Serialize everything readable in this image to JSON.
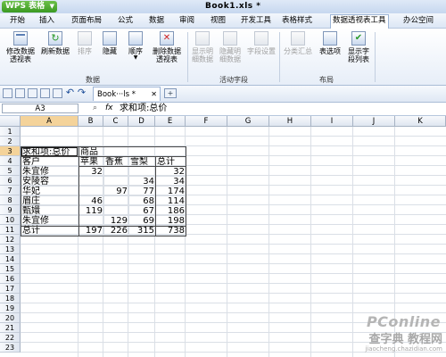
{
  "app": {
    "button_label": "WPS 表格",
    "doc_title": "Book1.xls *"
  },
  "menus": [
    "开始",
    "插入",
    "页面布局",
    "公式",
    "数据",
    "审阅",
    "视图",
    "开发工具",
    "表格样式",
    "数据透视表工具",
    "办公空间"
  ],
  "active_menu": "数据透视表工具",
  "ribbon": {
    "groups": [
      {
        "label": "数据",
        "buttons": [
          {
            "label": "修改数据\n透视表",
            "icon": "pivot-edit-icon",
            "enabled": true
          },
          {
            "label": "刷新数据",
            "icon": "refresh-icon",
            "enabled": true
          },
          {
            "label": "排序",
            "icon": "sort-icon",
            "enabled": false
          },
          {
            "label": "隐藏",
            "icon": "hide-icon",
            "enabled": true
          },
          {
            "label": "顺序",
            "icon": "order-icon",
            "enabled": true
          },
          {
            "label": "删除数据\n透视表",
            "icon": "delete-pivot-icon",
            "enabled": true
          }
        ]
      },
      {
        "label": "活动字段",
        "buttons": [
          {
            "label": "显示明\n细数据",
            "icon": "show-detail-icon",
            "enabled": false
          },
          {
            "label": "隐藏明\n细数据",
            "icon": "hide-detail-icon",
            "enabled": false
          },
          {
            "label": "字段设置",
            "icon": "field-settings-icon",
            "enabled": false
          }
        ]
      },
      {
        "label": "布局",
        "buttons": [
          {
            "label": "分类汇总",
            "icon": "subtotal-icon",
            "enabled": false
          },
          {
            "label": "表选项",
            "icon": "table-options-icon",
            "enabled": true
          },
          {
            "label": "显示字\n段列表",
            "icon": "field-list-icon",
            "enabled": true
          }
        ]
      }
    ]
  },
  "quickbar": {
    "tab_label": "Book···ls *"
  },
  "formula_bar": {
    "cell_ref": "A3",
    "fx": "fx",
    "content": "求和项:总价"
  },
  "sheet": {
    "columns": [
      "A",
      "B",
      "C",
      "D",
      "E",
      "F",
      "G",
      "H",
      "I",
      "J",
      "K"
    ],
    "rows": [
      "1",
      "2",
      "3",
      "4",
      "5",
      "6",
      "7",
      "8",
      "9",
      "10",
      "11",
      "12",
      "13",
      "14",
      "15",
      "16",
      "17",
      "18",
      "19",
      "20",
      "21",
      "22",
      "23"
    ],
    "pivot": {
      "row3": {
        "a": "求和项:总价",
        "b": "商品"
      },
      "row4": {
        "a": "客户",
        "b": "苹果",
        "c": "香蕉",
        "d": "雪梨",
        "e": "总计"
      },
      "data": [
        {
          "a": " 朱宜修",
          "b": "32",
          "c": "",
          "d": "",
          "e": "32"
        },
        {
          "a": "安陵容",
          "b": "",
          "c": "",
          "d": "34",
          "e": "34"
        },
        {
          "a": "华妃",
          "b": "",
          "c": "97",
          "d": "77",
          "e": "174"
        },
        {
          "a": "眉庄",
          "b": "46",
          "c": "",
          "d": "68",
          "e": "114"
        },
        {
          "a": "甄嬛",
          "b": "119",
          "c": "",
          "d": "67",
          "e": "186"
        },
        {
          "a": "朱宜修",
          "b": "",
          "c": "129",
          "d": "69",
          "e": "198"
        },
        {
          "a": "总计",
          "b": "197",
          "c": "226",
          "d": "315",
          "e": "738"
        }
      ]
    }
  },
  "watermark": {
    "line1": "PConline",
    "line2": "查字典 教程网",
    "line3": "jiaocheng.chazidian.com"
  }
}
